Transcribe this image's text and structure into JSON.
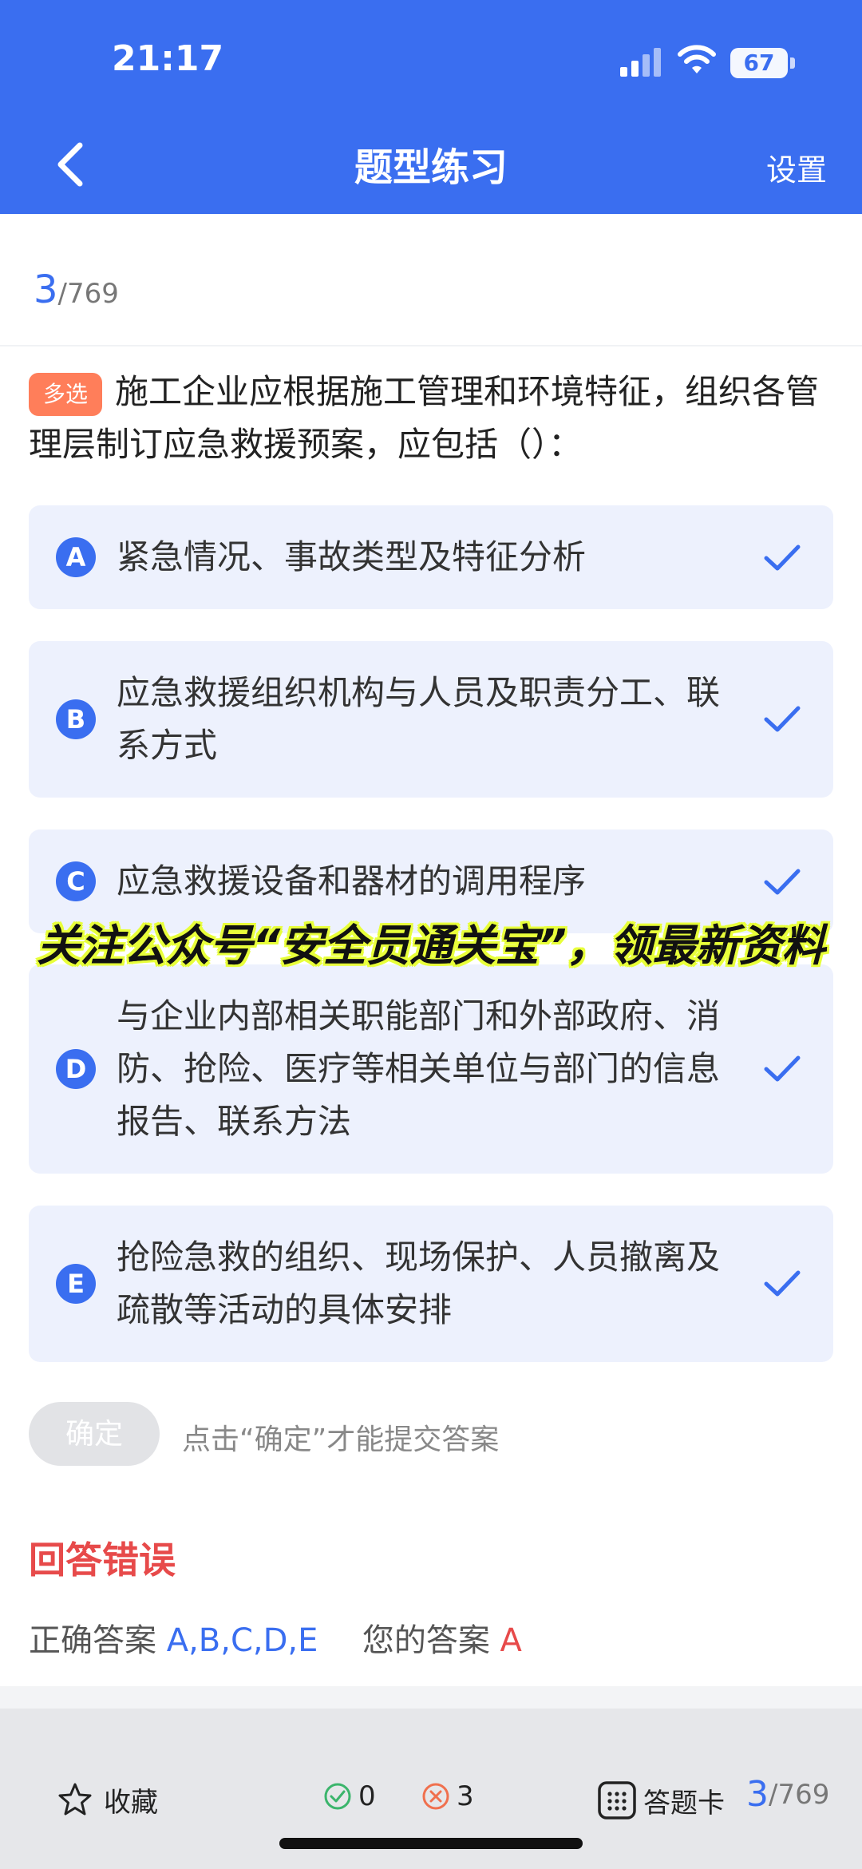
{
  "status": {
    "time": "21:17",
    "battery": "67",
    "battery_level_percent": 67
  },
  "header": {
    "title": "题型练习",
    "settings_label": "设置",
    "back_icon": "chevron-left-icon"
  },
  "progress": {
    "current": "3",
    "total": "/769"
  },
  "question": {
    "type_tag": "多选",
    "text": "施工企业应根据施工管理和环境特征，组织各管理层制订应急救援预案，应包括（）："
  },
  "options": [
    {
      "letter": "A",
      "text": "紧急情况、事故类型及特征分析",
      "selected": true
    },
    {
      "letter": "B",
      "text": "应急救援组织机构与人员及职责分工、联系方式",
      "selected": true
    },
    {
      "letter": "C",
      "text": "应急救援设备和器材的调用程序",
      "selected": true
    },
    {
      "letter": "D",
      "text": "与企业内部相关职能部门和外部政府、消防、抢险、医疗等相关单位与部门的信息报告、联系方法",
      "selected": true
    },
    {
      "letter": "E",
      "text": "抢险急救的组织、现场保护、人员撤离及疏散等活动的具体安排",
      "selected": true
    }
  ],
  "overlay_text": "关注公众号“安全员通关宝”，领最新资料",
  "confirm": {
    "button_label": "确定",
    "hint": "点击“确定”才能提交答案"
  },
  "result": {
    "title": "回答错误",
    "correct_label": "正确答案",
    "correct_value": "A,B,C,D,E",
    "yours_label": "您的答案",
    "yours_value": "A"
  },
  "bottom_bar": {
    "favorite_label": "收藏",
    "correct_count": "0",
    "wrong_count": "3",
    "answer_card_label": "答题卡",
    "progress_current": "3",
    "progress_total": "/769"
  },
  "colors": {
    "primary": "#3a6ef0",
    "error": "#e74a4a",
    "tag": "#ff7e5a",
    "option_bg": "#edf1fd"
  }
}
